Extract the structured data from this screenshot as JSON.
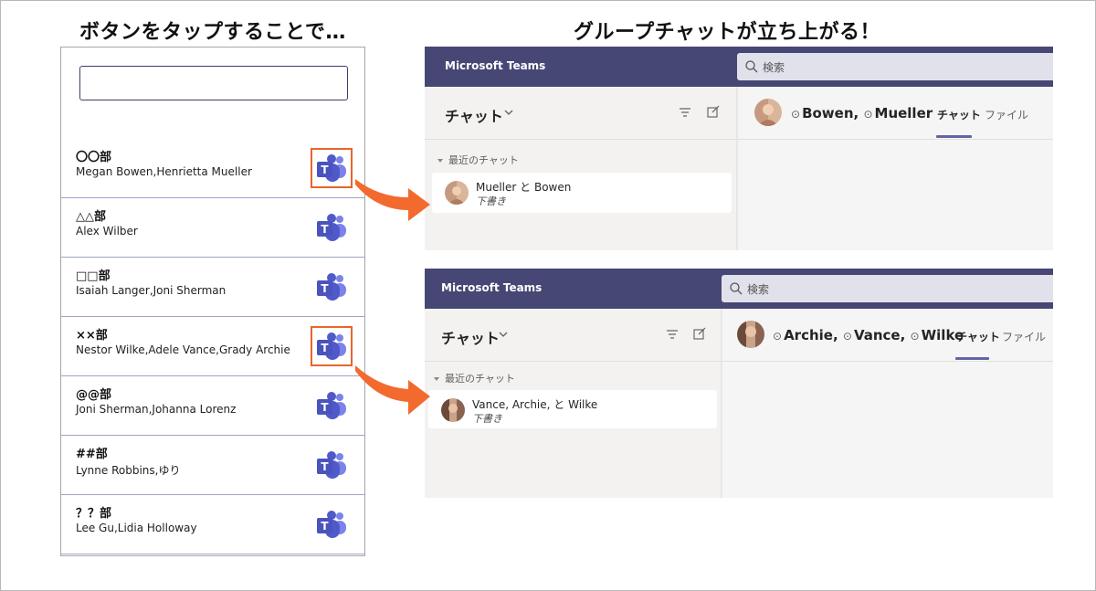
{
  "heading_left": "ボタンをタップすることで…",
  "heading_right": "グループチャットが立ち上がる！",
  "app": {
    "search_value": "",
    "departments": [
      {
        "name": "〇〇部",
        "members": "Megan Bowen,Henrietta Mueller"
      },
      {
        "name": "△△部",
        "members": "Alex Wilber"
      },
      {
        "name": "□□部",
        "members": "Isaiah Langer,Joni Sherman"
      },
      {
        "name": "××部",
        "members": "Nestor Wilke,Adele Vance,Grady Archie"
      },
      {
        "name": "@@部",
        "members": "Joni Sherman,Johanna Lorenz"
      },
      {
        "name": "##部",
        "members": "Lynne Robbins,ゆり"
      },
      {
        "name": "？？部",
        "members": "Lee Gu,Lidia Holloway"
      }
    ]
  },
  "teams_top": {
    "title": "Microsoft Teams",
    "search_placeholder": "検索",
    "chat_label": "チャット",
    "recent_label": "最近のチャット",
    "chat_item": {
      "name": "Mueller と Bowen",
      "status": "下書き"
    },
    "conversation": {
      "name1": "Bowen,",
      "name2": "Mueller"
    },
    "tabs": {
      "chat": "チャット",
      "files": "ファイル"
    }
  },
  "teams_bottom": {
    "title": "Microsoft Teams",
    "search_placeholder": "検索",
    "chat_label": "チャット",
    "recent_label": "最近のチャット",
    "chat_item": {
      "name": "Vance, Archie, と Wilke",
      "status": "下書き"
    },
    "conversation": {
      "name1": "Archie,",
      "name2": "Vance,",
      "name3": "Wilke"
    },
    "tabs": {
      "chat": "チャット",
      "files": "ファイル"
    }
  },
  "colors": {
    "teams_purple": "#464775",
    "teams_accent": "#6264a7",
    "highlight_orange": "#e8652d",
    "arrow_orange": "#f26a2e"
  },
  "icons": {
    "row_button": "teams-logo-icon",
    "search": "search-icon",
    "filter": "filter-icon",
    "compose": "compose-icon",
    "dropdown": "chevron-down-icon"
  }
}
